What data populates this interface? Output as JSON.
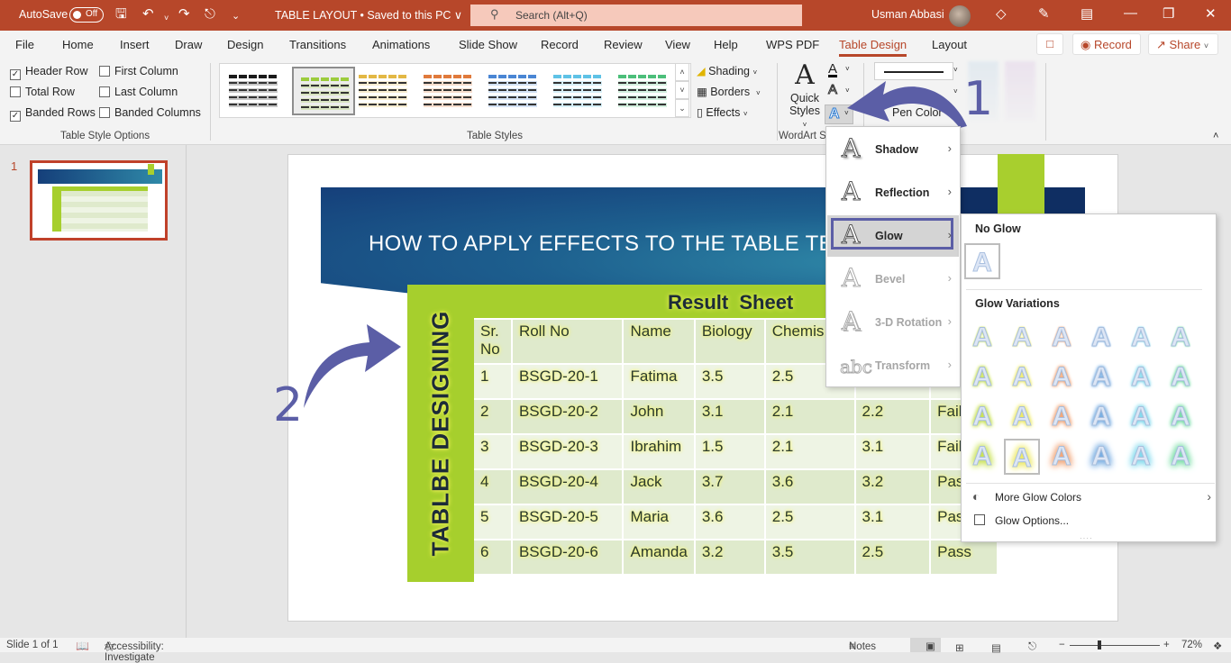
{
  "titlebar": {
    "autosave_label": "AutoSave",
    "autosave_state": "Off",
    "doc_title": "TABLE LAYOUT • Saved to this PC ∨",
    "search_placeholder": "Search (Alt+Q)",
    "user_name": "Usman Abbasi"
  },
  "menu_tabs": [
    "File",
    "Home",
    "Insert",
    "Draw",
    "Design",
    "Transitions",
    "Animations",
    "Slide Show",
    "Record",
    "Review",
    "View",
    "Help",
    "WPS PDF",
    "Table Design",
    "Layout"
  ],
  "active_tab": "Table Design",
  "top_buttons": {
    "record": "Record",
    "share": "Share"
  },
  "ribbon": {
    "table_style_options": {
      "group_label": "Table Style Options",
      "options": [
        {
          "label": "Header Row",
          "checked": true
        },
        {
          "label": "First Column",
          "checked": false
        },
        {
          "label": "Total Row",
          "checked": false
        },
        {
          "label": "Last Column",
          "checked": false
        },
        {
          "label": "Banded Rows",
          "checked": true
        },
        {
          "label": "Banded Columns",
          "checked": false
        }
      ]
    },
    "table_styles": {
      "group_label": "Table Styles",
      "swatch_colors": [
        "#1a1a1a",
        "#9ccc3c",
        "#e3b844",
        "#e07a3c",
        "#4a86d4",
        "#5fc2e6",
        "#4cbf7a"
      ],
      "selected_index": 1,
      "shading": "Shading",
      "borders": "Borders",
      "effects": "Effects"
    },
    "wordart": {
      "group_label": "WordArt S",
      "quick_styles": [
        "Quick",
        "Styles"
      ]
    },
    "draw_borders": {
      "pen_color": "Pen Color"
    }
  },
  "text_effects_menu": {
    "items": [
      {
        "label": "Shadow",
        "enabled": true
      },
      {
        "label": "Reflection",
        "enabled": true
      },
      {
        "label": "Glow",
        "enabled": true,
        "highlighted": true
      },
      {
        "label": "Bevel",
        "enabled": false
      },
      {
        "label": "3-D Rotation",
        "enabled": false
      },
      {
        "label": "Transform",
        "enabled": false
      }
    ]
  },
  "glow_menu": {
    "no_glow_heading": "No Glow",
    "variations_heading": "Glow Variations",
    "variation_colors": [
      "#c6e04a",
      "#ece85a",
      "#f0a070",
      "#6fa8e0",
      "#7ad8ec",
      "#6fdca0"
    ],
    "selected": {
      "row": 4,
      "col": 2
    },
    "more_colors": "More Glow Colors",
    "options": "Glow Options..."
  },
  "slide": {
    "title": "HOW TO APPLY EFFECTS TO THE TABLE TE",
    "vertical_label": "TABLBE DESIGNING",
    "table_title": "Result  Sheet",
    "columns": [
      "Sr. No",
      "Roll No",
      "Name",
      "Biology",
      "Chemis",
      "",
      ""
    ],
    "rows": [
      [
        "1",
        "BSGD-20-1",
        "Fatima",
        "3.5",
        "2.5",
        "",
        ""
      ],
      [
        "2",
        "BSGD-20-2",
        "John",
        "3.1",
        "2.1",
        "2.2",
        "Fail"
      ],
      [
        "3",
        "BSGD-20-3",
        "Ibrahim",
        "1.5",
        "2.1",
        "3.1",
        "Fail"
      ],
      [
        "4",
        "BSGD-20-4",
        "Jack",
        "3.7",
        "3.6",
        "3.2",
        "Pass"
      ],
      [
        "5",
        "BSGD-20-5",
        "Maria",
        "3.6",
        "2.5",
        "3.1",
        "Pass"
      ],
      [
        "6",
        "BSGD-20-6",
        "Amanda",
        "3.2",
        "3.5",
        "2.5",
        "Pass"
      ]
    ]
  },
  "annotations": {
    "step1": "1",
    "step2": "2"
  },
  "thumbnail_number": "1",
  "statusbar": {
    "slide_info": "Slide 1 of 1",
    "accessibility": "Accessibility: Investigate",
    "notes": "Notes",
    "zoom": "72%"
  }
}
